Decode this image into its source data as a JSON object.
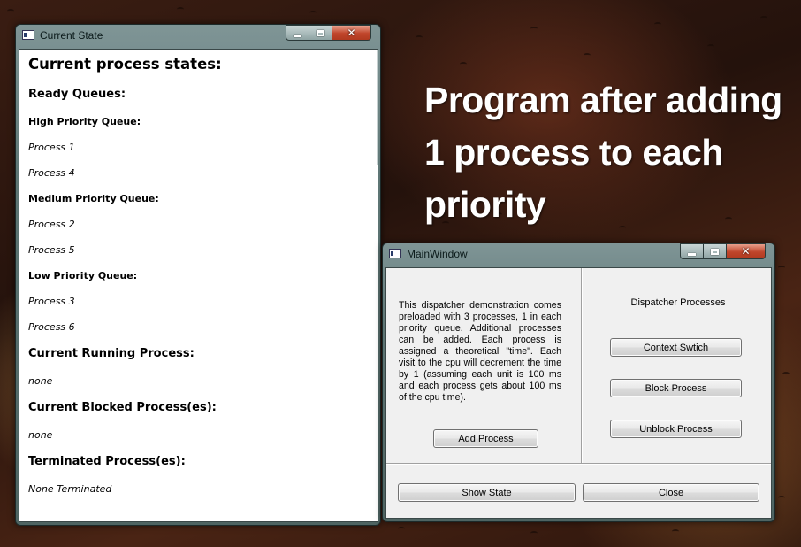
{
  "caption": {
    "line1": "Program after adding",
    "line2": "1 process to each",
    "line3": "priority"
  },
  "state_window": {
    "title": "Current State",
    "icon": "app-window-icon",
    "heading": "Current process states:",
    "ready_queues_label": "Ready Queues:",
    "high": {
      "label": "High Priority Queue:",
      "items": [
        "Process 1",
        "Process 4"
      ]
    },
    "medium": {
      "label": "Medium Priority Queue:",
      "items": [
        "Process 2",
        "Process 5"
      ]
    },
    "low": {
      "label": "Low Priority Queue:",
      "items": [
        "Process 3",
        "Process 6"
      ]
    },
    "running_label": "Current Running Process:",
    "running_value": "none",
    "blocked_label": "Current Blocked Process(es):",
    "blocked_value": "none",
    "terminated_label": "Terminated Process(es):",
    "terminated_value": "None Terminated"
  },
  "main_window": {
    "title": "MainWindow",
    "icon": "app-window-icon",
    "description": "This dispatcher demonstration comes preloaded with 3 processes, 1 in each priority queue. Additional processes can be added. Each process is assigned a theoretical \"time\". Each visit to the cpu will decrement the time by 1 (assuming each unit is 100 ms and each process gets about 100 ms of the cpu time).",
    "add_process": "Add Process",
    "dispatcher_label": "Dispatcher Processes",
    "context_switch": "Context Swtich",
    "block_process": "Block Process",
    "unblock_process": "Unblock Process",
    "show_state": "Show State",
    "close": "Close"
  },
  "window_buttons": {
    "minimize": "minimize-icon",
    "maximize": "maximize-icon",
    "close": "close-icon"
  },
  "colors": {
    "close_button": "#c0452b",
    "titlebar": "#6d8584",
    "client_bg": "#f0f0f0"
  }
}
